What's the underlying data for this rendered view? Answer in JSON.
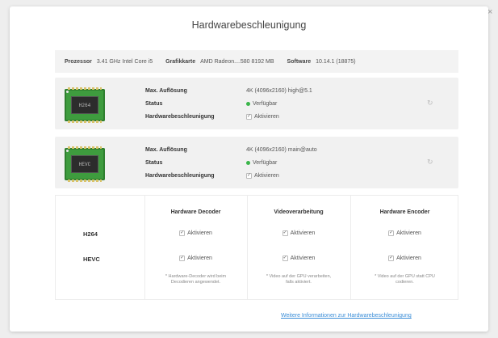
{
  "dialog": {
    "title": "Hardwarebeschleunigung",
    "close_icon": "×",
    "sysinfo": {
      "processor_label": "Prozessor",
      "processor_value": "3.41 GHz Intel Core i5",
      "gpu_label": "Grafikkarte",
      "gpu_value": "AMD Radeon....580 8192 MB",
      "software_label": "Software",
      "software_value": "10.14.1 (18875)"
    },
    "codecs": [
      {
        "chip_label": "H264",
        "res_label": "Max. Auflösung",
        "res_value": "4K (4096x2160) high@5.1",
        "status_label": "Status",
        "status_value": "Verfügbar",
        "status_color": "#3ab54a",
        "accel_label": "Hardwarebeschleunigung",
        "accel_value": "Aktivieren"
      },
      {
        "chip_label": "HEVC",
        "res_label": "Max. Auflösung",
        "res_value": "4K (4096x2160) main@auto",
        "status_label": "Status",
        "status_value": "Verfügbar",
        "status_color": "#3ab54a",
        "accel_label": "Hardwarebeschleunigung",
        "accel_value": "Aktivieren"
      }
    ],
    "matrix": {
      "columns": [
        "Hardware Decoder",
        "Videoverarbeitung",
        "Hardware Encoder"
      ],
      "rows": [
        "H264",
        "HEVC"
      ],
      "cell_label": "Aktivieren",
      "notes": [
        "* Hardware-Decoder wird beim Decodieren angewendet.",
        "* Video auf der GPU verarbeiten, falls aktiviert.",
        "* Video auf der GPU statt CPU codieren."
      ]
    },
    "link": "Weitere Informationen zur Hardwarebeschleunigung",
    "chip_color": "#3e9c3e",
    "link_color": "#3b8ed8"
  }
}
